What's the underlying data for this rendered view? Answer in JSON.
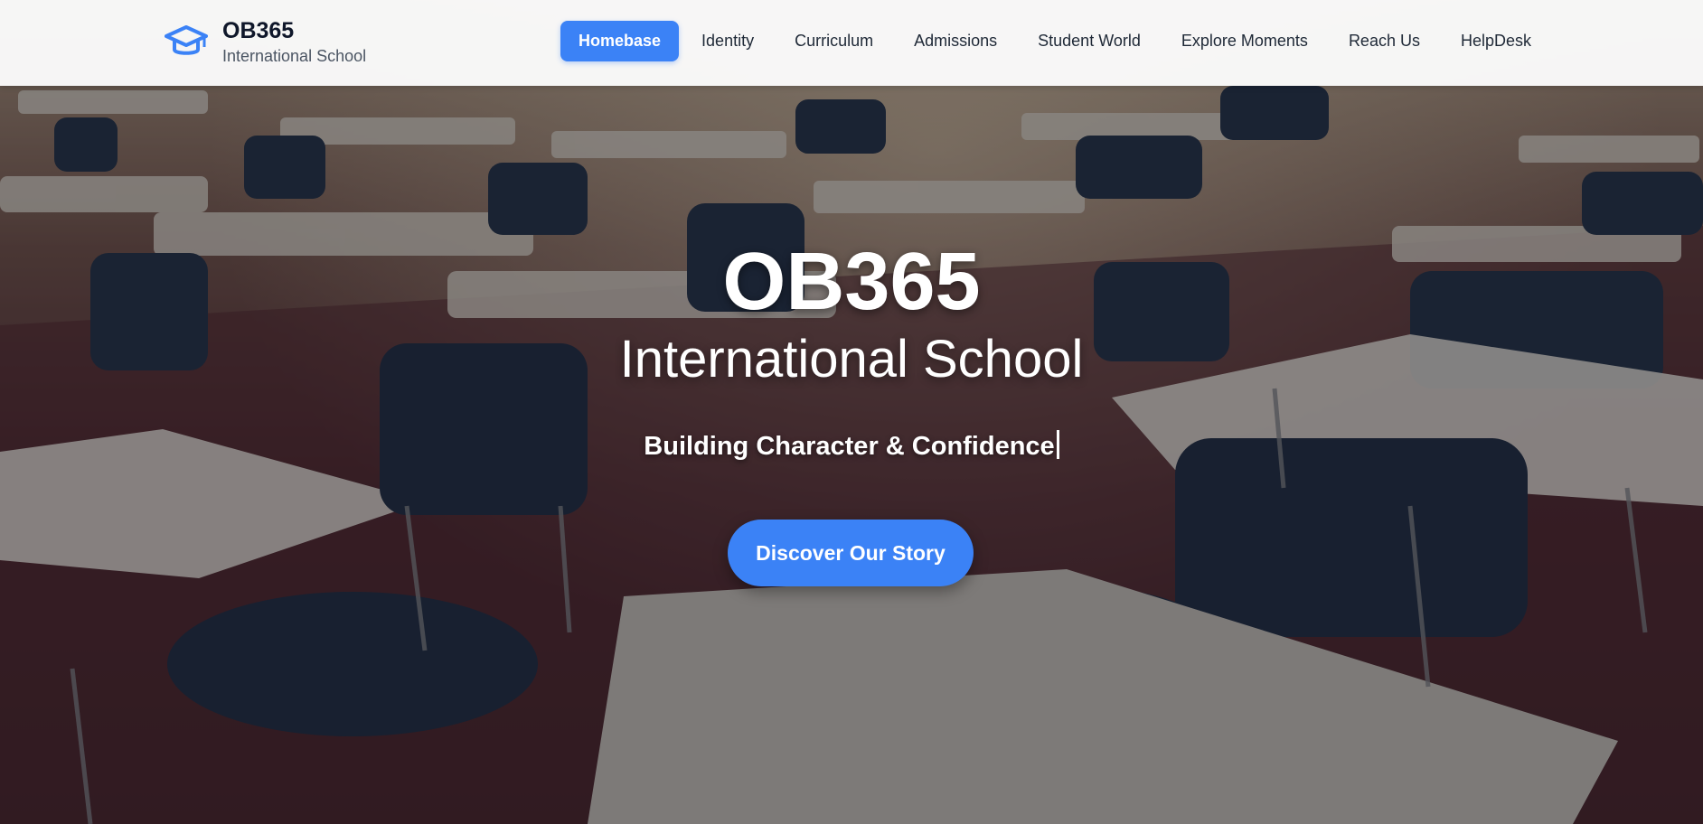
{
  "brand": {
    "name": "OB365",
    "subtitle": "International School",
    "logo_icon": "graduation-cap-icon",
    "accent_color": "#3b82f6"
  },
  "nav": {
    "items": [
      {
        "label": "Homebase",
        "active": true
      },
      {
        "label": "Identity",
        "active": false
      },
      {
        "label": "Curriculum",
        "active": false
      },
      {
        "label": "Admissions",
        "active": false
      },
      {
        "label": "Student World",
        "active": false
      },
      {
        "label": "Explore Moments",
        "active": false
      },
      {
        "label": "Reach Us",
        "active": false
      },
      {
        "label": "HelpDesk",
        "active": false
      }
    ]
  },
  "hero": {
    "title": "OB365",
    "subtitle": "International School",
    "tagline": "Building Character & Confidence",
    "cta_label": "Discover Our Story",
    "background_image": "classroom-desks-image"
  }
}
